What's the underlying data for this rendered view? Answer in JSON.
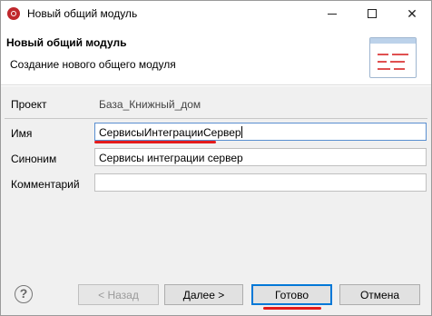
{
  "window": {
    "title": "Новый общий модуль",
    "icon": "app-logo-icon"
  },
  "header": {
    "title": "Новый общий модуль",
    "subtitle": "Создание нового общего модуля",
    "icon": "module-form-icon"
  },
  "form": {
    "project_label": "Проект",
    "project_value": "База_Книжный_дом",
    "name_label": "Имя",
    "name_value": "СервисыИнтеграцииСервер",
    "synonym_label": "Синоним",
    "synonym_value": "Сервисы интеграции сервер",
    "comment_label": "Комментарий",
    "comment_value": ""
  },
  "buttons": {
    "help": "?",
    "back": "< Назад",
    "next": "Далее >",
    "finish": "Готово",
    "cancel": "Отмена"
  },
  "colors": {
    "highlight": "#e41b1b",
    "accent": "#0078d7"
  }
}
